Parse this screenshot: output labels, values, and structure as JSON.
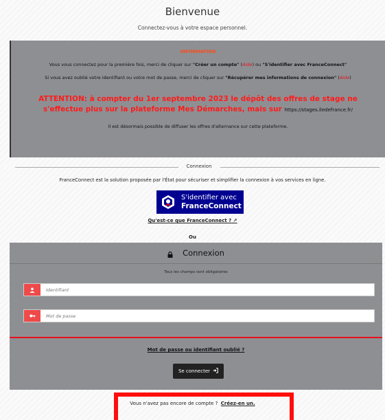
{
  "header": {
    "title": "Bienvenue",
    "subtitle": "Connectez-vous à votre espace personnel."
  },
  "info": {
    "heading": "INFORMATION",
    "line1_a": "Vous vous connectez pour la première fois, merci de cliquer sur ",
    "line1_b": "\"Créer un compte\"",
    "line1_c": " (",
    "line1_d": "Aide",
    "line1_e": ") ou ",
    "line1_f": "\"S'identifier avec FranceConnect\"",
    "line2_a": "Si vous avez oublié votre identifiant ou votre mot de passe, merci de cliquer sur ",
    "line2_b": "\"Récupérer mes informations de connexion\"",
    "line2_c": " (",
    "line2_d": "Aide",
    "line2_e": ")",
    "attention": "ATTENTION: à compter du 1er septembre 2023 le dépôt des offres de stage ne s'effectue plus sur la plateforme Mes Démarches, mais sur ",
    "attention_url": "https://stages.iledefrance.fr/",
    "line3": "Il est désormais possible de diffuser les offres d'alternance sur cette plateforme."
  },
  "separator": {
    "label": "Connexion"
  },
  "franceconnect": {
    "description": "FranceConnect est la solution proposée par l'État pour sécuriser et simplifier la connexion à vos services en ligne.",
    "button_line1": "S'identifier avec",
    "button_line2": "FranceConnect",
    "link_label": "Qu'est-ce que FranceConnect ?",
    "or_label": "Ou"
  },
  "login": {
    "title": "Connexion",
    "required_note": "Tous les champs sont obligatoires",
    "username_placeholder": "Identifiant",
    "password_placeholder": "Mot de passe",
    "forgot_label": "Mot de passe ou identifiant oublié ?",
    "submit_label": "Se connecter"
  },
  "signup": {
    "prompt": "Vous n'avez pas encore de compte ?",
    "link_label": "Créez-en un."
  },
  "colors": {
    "panel": "#8e8f93",
    "accent_red": "#e8101d",
    "franceconnect_blue": "#000091"
  }
}
